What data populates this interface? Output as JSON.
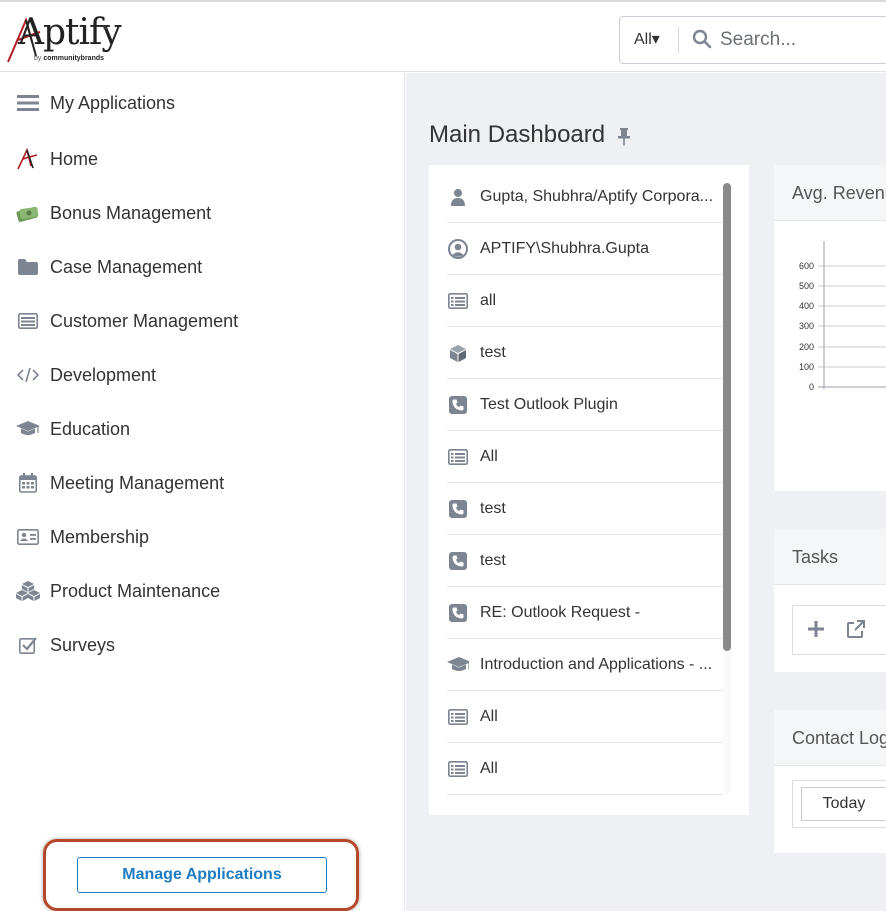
{
  "header": {
    "logo_text": "Aptify",
    "logo_sub_by": "by ",
    "logo_sub_brand": "communitybrands",
    "search": {
      "scope": "All▾",
      "placeholder": "Search..."
    }
  },
  "sidebar": {
    "items": [
      {
        "label": "My Applications",
        "icon": "hamburger-icon"
      },
      {
        "label": "Home",
        "icon": "aptify-a-icon"
      },
      {
        "label": "Bonus Management",
        "icon": "money-icon"
      },
      {
        "label": "Case Management",
        "icon": "folder-icon"
      },
      {
        "label": "Customer Management",
        "icon": "list-card-icon"
      },
      {
        "label": "Development",
        "icon": "code-icon"
      },
      {
        "label": "Education",
        "icon": "graduation-cap-icon"
      },
      {
        "label": "Meeting Management",
        "icon": "calendar-icon"
      },
      {
        "label": "Membership",
        "icon": "id-card-icon"
      },
      {
        "label": "Product Maintenance",
        "icon": "cubes-icon"
      },
      {
        "label": "Surveys",
        "icon": "check-square-icon"
      }
    ],
    "manage_button": "Manage Applications"
  },
  "main": {
    "title": "Main Dashboard",
    "recent_items": [
      {
        "label": "Gupta, Shubhra/Aptify Corpora...",
        "icon": "person-icon"
      },
      {
        "label": "APTIFY\\Shubhra.Gupta",
        "icon": "user-circle-icon"
      },
      {
        "label": "all",
        "icon": "list-icon"
      },
      {
        "label": "test",
        "icon": "cube-icon"
      },
      {
        "label": "Test Outlook Plugin",
        "icon": "phone-icon"
      },
      {
        "label": "All",
        "icon": "list-icon"
      },
      {
        "label": "test",
        "icon": "phone-icon"
      },
      {
        "label": "test",
        "icon": "phone-icon"
      },
      {
        "label": "RE: Outlook Request -",
        "icon": "phone-icon"
      },
      {
        "label": "Introduction and Applications - ...",
        "icon": "graduation-cap-icon"
      },
      {
        "label": "All",
        "icon": "list-icon"
      },
      {
        "label": "All",
        "icon": "list-icon"
      }
    ],
    "revenue_card": {
      "title": "Avg. Revenue",
      "y_ticks": [
        "600",
        "500",
        "400",
        "300",
        "200",
        "100",
        "0"
      ]
    },
    "tasks_card": {
      "title": "Tasks"
    },
    "contact_card": {
      "title": "Contact Log",
      "today_button": "Today"
    }
  },
  "colors": {
    "accent_blue": "#1e7cc4",
    "highlight_ring": "#b5472a",
    "icon_gray": "#7c8591"
  }
}
